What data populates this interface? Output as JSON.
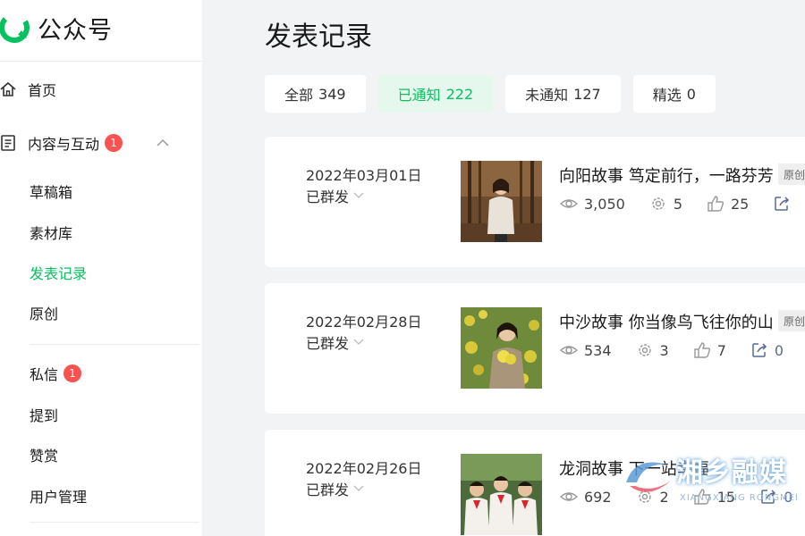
{
  "brand": {
    "name": "公众号"
  },
  "nav": {
    "home": "首页",
    "content": {
      "label": "内容与互动",
      "badge": "1"
    },
    "sub": [
      "草稿箱",
      "素材库",
      "发表记录",
      "原创"
    ],
    "messages": {
      "label": "私信",
      "badge": "1"
    },
    "mentions": "提到",
    "rewards": "赞赏",
    "users": "用户管理"
  },
  "page": {
    "title": "发表记录"
  },
  "tabs": [
    {
      "label": "全部",
      "count": "349"
    },
    {
      "label": "已通知",
      "count": "222"
    },
    {
      "label": "未通知",
      "count": "127"
    },
    {
      "label": "精选",
      "count": "0"
    }
  ],
  "active_tab": "已通知",
  "records": [
    {
      "date": "2022年03月01日",
      "status": "已群发",
      "title": "向阳故事 笃定前行，一路芬芳",
      "tag": "原创",
      "views": "3,050",
      "shares": "5",
      "likes": "25",
      "forwards": ""
    },
    {
      "date": "2022年02月28日",
      "status": "已群发",
      "title": "中沙故事 你当像鸟飞往你的山",
      "tag": "原创",
      "views": "534",
      "shares": "3",
      "likes": "7",
      "forwards": "0"
    },
    {
      "date": "2022年02月26日",
      "status": "已群发",
      "title": "龙洞故事 下一站幸福",
      "tag": "",
      "views": "692",
      "shares": "2",
      "likes": "15",
      "forwards": "0"
    }
  ],
  "watermark": {
    "text": "湘乡融媒",
    "sub": "XIANGXIANG RONGMEI"
  },
  "colors": {
    "accent": "#07c160",
    "badge": "#fa5151",
    "link": "#576b95"
  }
}
